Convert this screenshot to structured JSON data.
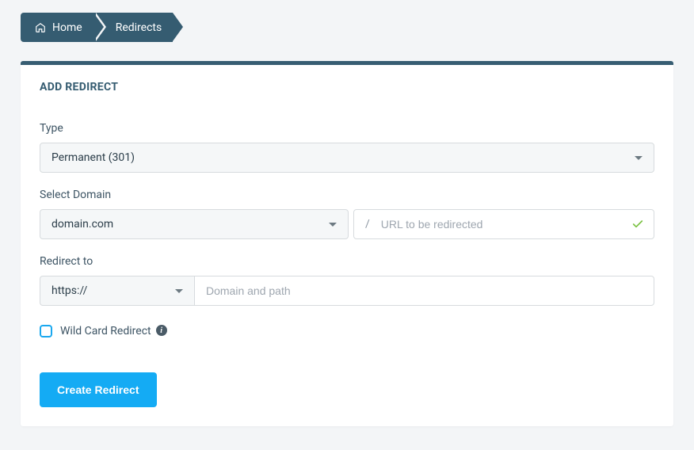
{
  "breadcrumb": {
    "home_label": "Home",
    "current_label": "Redirects"
  },
  "panel": {
    "title": "ADD REDIRECT"
  },
  "form": {
    "type_label": "Type",
    "type_value": "Permanent (301)",
    "select_domain_label": "Select Domain",
    "domain_value": "domain.com",
    "slash": "/",
    "url_placeholder": "URL to be redirected",
    "url_value": "",
    "redirect_to_label": "Redirect to",
    "protocol_value": "https://",
    "redirect_path_placeholder": "Domain and path",
    "redirect_path_value": "",
    "wildcard_label": "Wild Card Redirect",
    "wildcard_checked": false,
    "info_symbol": "i",
    "submit_label": "Create Redirect"
  }
}
